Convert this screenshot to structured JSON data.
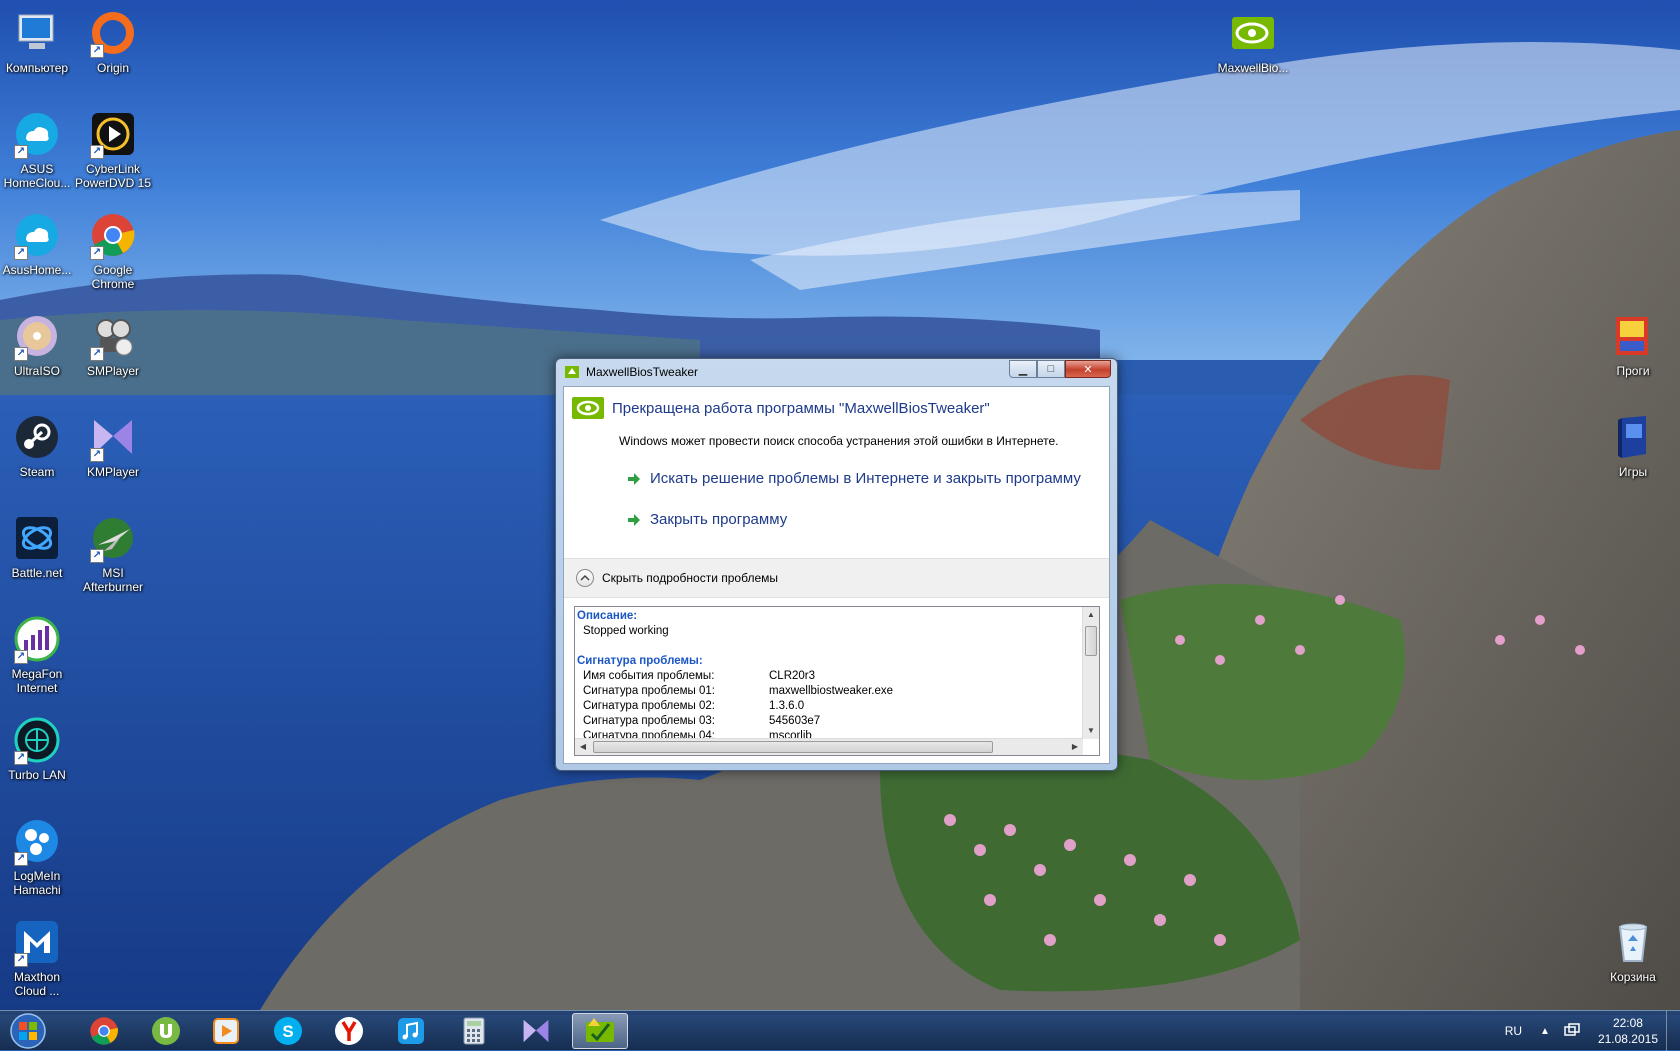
{
  "desktop": {
    "icons": [
      {
        "label": "Компьютер",
        "icon": "computer-icon"
      },
      {
        "label": "Origin",
        "icon": "origin-icon"
      },
      {
        "label": "ASUS\nHomeClou...",
        "icon": "cloud-icon"
      },
      {
        "label": "CyberLink\nPowerDVD 15",
        "icon": "powerdvd-icon"
      },
      {
        "label": "AsusHome...",
        "icon": "cloud-icon"
      },
      {
        "label": "Google\nChrome",
        "icon": "chrome-icon"
      },
      {
        "label": "UltraISO",
        "icon": "disc-icon"
      },
      {
        "label": "SMPlayer",
        "icon": "smplayer-icon"
      },
      {
        "label": "Steam",
        "icon": "steam-icon"
      },
      {
        "label": "KMPlayer",
        "icon": "kmplayer-icon"
      },
      {
        "label": "Battle.net",
        "icon": "battlenet-icon"
      },
      {
        "label": "MSI\nAfterburner",
        "icon": "afterburner-icon"
      },
      {
        "label": "MegaFon\nInternet",
        "icon": "megafon-icon"
      },
      {
        "label": "Turbo LAN",
        "icon": "turbolan-icon"
      },
      {
        "label": "LogMeIn\nHamachi",
        "icon": "hamachi-icon"
      },
      {
        "label": "Maxthon\nCloud ...",
        "icon": "maxthon-icon"
      },
      {
        "label": "MaxwellBio...",
        "icon": "nvidia-icon"
      },
      {
        "label": "Проги",
        "icon": "folder-icon"
      },
      {
        "label": "Игры",
        "icon": "book-icon"
      },
      {
        "label": "Корзина",
        "icon": "recycle-bin-icon"
      }
    ]
  },
  "dialog": {
    "window_title": "MaxwellBiosTweaker",
    "heading": "Прекращена работа программы \"MaxwellBiosTweaker\"",
    "subtext": "Windows может провести поиск способа устранения этой ошибки в Интернете.",
    "action_search": "Искать решение проблемы в Интернете и закрыть программу",
    "action_close": "Закрыть программу",
    "details_toggle": "Скрыть подробности проблемы",
    "details": {
      "description_title": "Описание:",
      "description_text": "Stopped working",
      "signature_title": "Сигнатура проблемы:",
      "rows": [
        {
          "key": "Имя события проблемы:",
          "value": "CLR20r3"
        },
        {
          "key": "Сигнатура проблемы 01:",
          "value": "maxwellbiostweaker.exe"
        },
        {
          "key": "Сигнатура проблемы 02:",
          "value": "1.3.6.0"
        },
        {
          "key": "Сигнатура проблемы 03:",
          "value": "545603e7"
        },
        {
          "key": "Сигнатура проблемы 04:",
          "value": "mscorlib"
        }
      ]
    }
  },
  "taskbar": {
    "pinned": [
      "chrome-icon",
      "utorrent-icon",
      "media-player-icon",
      "skype-icon",
      "yandex-icon",
      "itunes-icon",
      "calculator-icon",
      "kmplayer-icon",
      "maxwellbiostweaker-icon"
    ],
    "language": "RU",
    "time": "22:08",
    "date": "21.08.2015"
  },
  "colors": {
    "dialog_heading": "#1e3a8a",
    "details_section": "#1a56c4",
    "close_button": "#c4412d"
  }
}
